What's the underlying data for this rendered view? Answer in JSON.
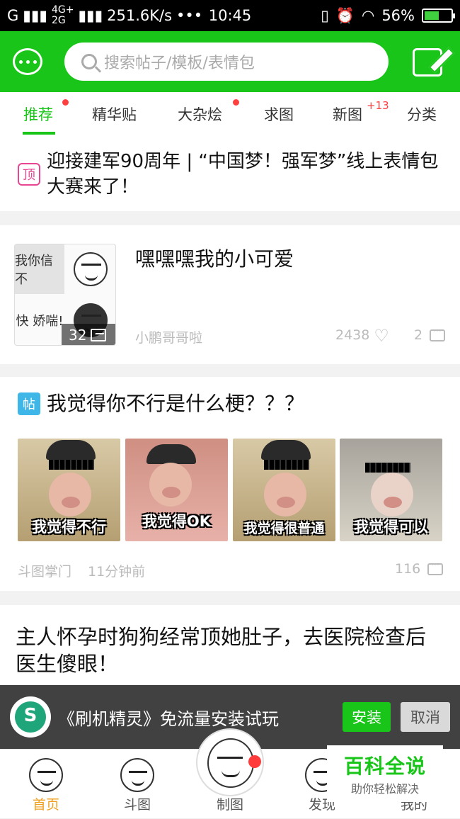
{
  "status_bar": {
    "signal1": "G",
    "net_top": "4G+",
    "net_bottom": "2G",
    "speed": "251.6K/s",
    "dots": "•••",
    "time": "10:45",
    "battery": "56%"
  },
  "header": {
    "search_placeholder": "搜索帖子/模板/表情包"
  },
  "tabs": [
    {
      "label": "推荐",
      "active": true,
      "dot": true
    },
    {
      "label": "精华贴",
      "active": false,
      "dot": false
    },
    {
      "label": "大杂烩",
      "active": false,
      "dot": true
    },
    {
      "label": "求图",
      "active": false,
      "dot": false
    },
    {
      "label": "新图",
      "active": false,
      "badge": "+13"
    },
    {
      "label": "分类",
      "active": false,
      "dot": false
    }
  ],
  "feed": {
    "pinned": {
      "tag": "顶",
      "title": "迎接建军90周年 | “中国梦！强军梦”线上表情包大赛来了！"
    },
    "post1": {
      "title": "嘿嘿嘿我的小可爱",
      "thumb_texts": [
        "我你信不",
        "快 娇喘!"
      ],
      "image_count": "32",
      "author": "小鹏哥哥啦",
      "likes": "2438",
      "comments": "2"
    },
    "post2": {
      "tag": "帖",
      "title": "我觉得你不行是什么梗？？？",
      "images": [
        {
          "caption": "我觉得不行"
        },
        {
          "caption": "我觉得OK"
        },
        {
          "caption": "我觉得很普通"
        },
        {
          "caption": "我觉得可以"
        }
      ],
      "author": "斗图掌门",
      "time": "11分钟前",
      "comments": "116"
    },
    "post3": {
      "title": "主人怀孕时狗狗经常顶她肚子，去医院检查后医生傻眼！"
    }
  },
  "install_banner": {
    "text": "《刷机精灵》免流量安装试玩",
    "install_label": "安装",
    "cancel_label": "取消"
  },
  "bottom_nav": [
    {
      "label": "首页",
      "active": true
    },
    {
      "label": "斗图",
      "active": false
    },
    {
      "label": "制图",
      "active": false
    },
    {
      "label": "发现",
      "active": false
    },
    {
      "label": "我的",
      "active": false
    }
  ],
  "watermark": {
    "title": "百科全说",
    "subtitle": "助你轻松解决"
  },
  "colors": {
    "brand_green": "#19c519",
    "accent_red": "#ff4040",
    "active_nav": "#f0a020"
  }
}
